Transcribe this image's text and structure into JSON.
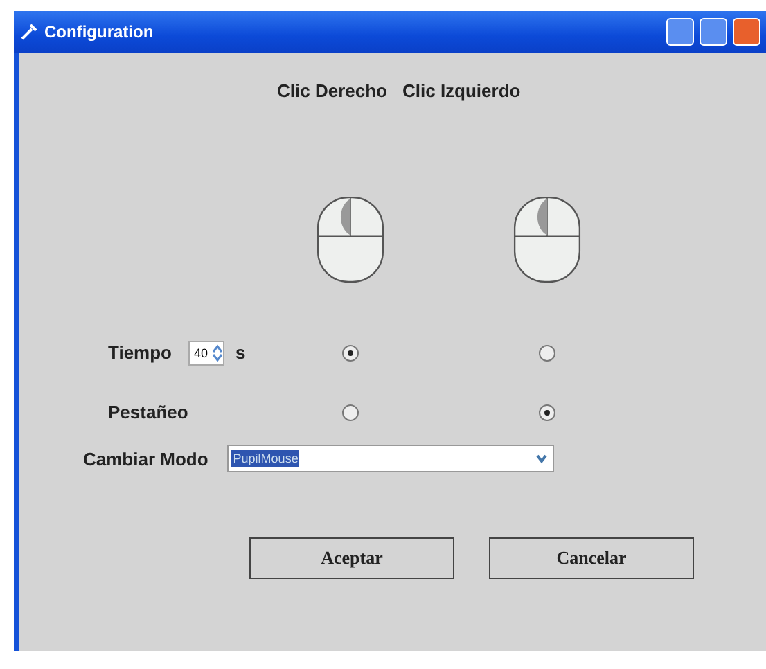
{
  "window": {
    "title": "Configuration"
  },
  "columns": [
    "Clic Derecho",
    "Clic Izquierdo"
  ],
  "rows": [
    {
      "label": "Tiempo",
      "kind": "spinner",
      "value": "40",
      "unit": "s",
      "options": [
        {
          "selected": true
        },
        {
          "selected": false
        }
      ]
    },
    {
      "label": "Pestañeo",
      "kind": "plain",
      "options": [
        {
          "selected": false
        },
        {
          "selected": true
        }
      ]
    }
  ],
  "mode": {
    "label": "Cambiar Modo",
    "value": "PupilMouse"
  },
  "buttons": [
    "Aceptar",
    "Cancelar"
  ]
}
